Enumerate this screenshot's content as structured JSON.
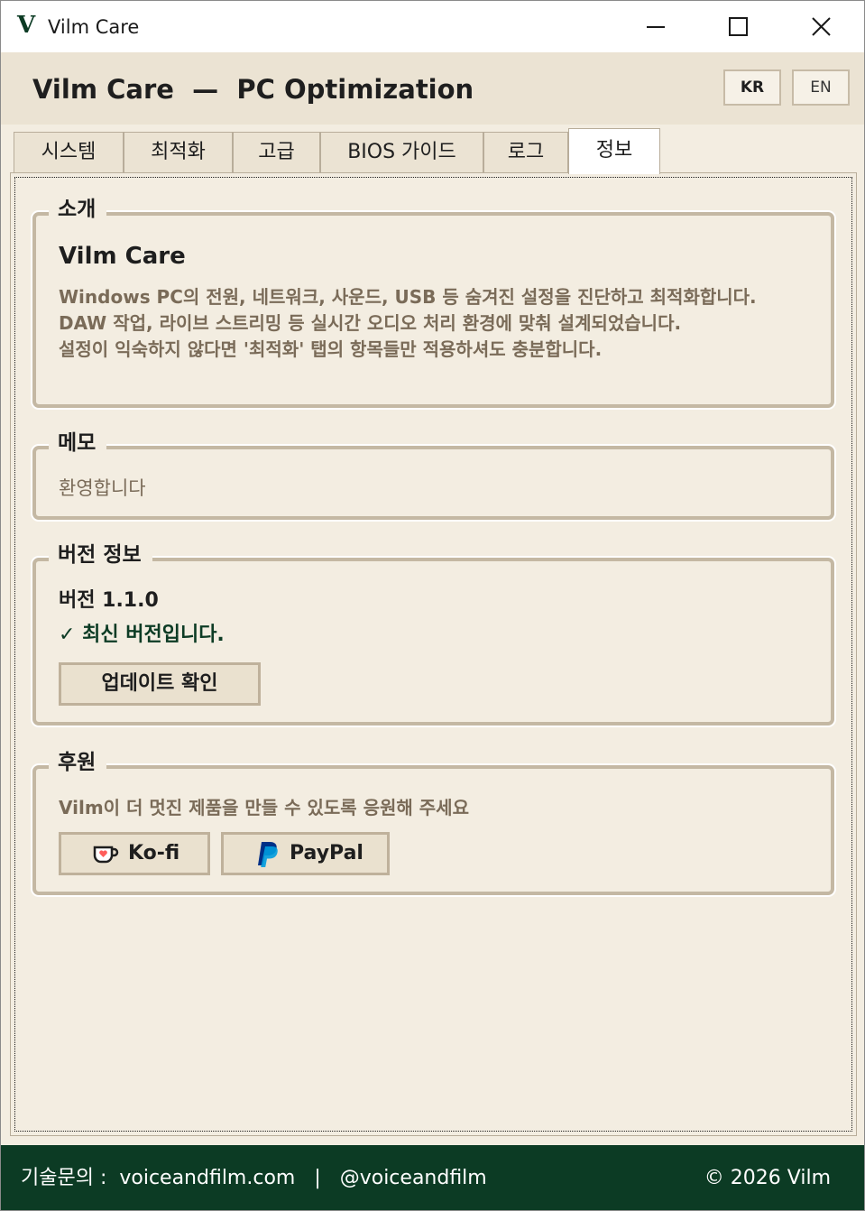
{
  "window": {
    "logo": "V",
    "title": "Vilm Care",
    "icons": {
      "minimize": "minimize-icon",
      "maximize": "maximize-icon",
      "close": "close-icon"
    }
  },
  "header": {
    "app_name": "Vilm Care",
    "separator": "—",
    "subtitle": "PC Optimization",
    "languages": [
      "KR",
      "EN"
    ],
    "selected_language": "KR"
  },
  "tabs": [
    {
      "label": "시스템",
      "active": false
    },
    {
      "label": "최적화",
      "active": false
    },
    {
      "label": "고급",
      "active": false
    },
    {
      "label": "BIOS 가이드",
      "active": false
    },
    {
      "label": "로그",
      "active": false
    },
    {
      "label": "정보",
      "active": true
    }
  ],
  "intro": {
    "title": "소개",
    "app_name": "Vilm Care",
    "description": "Windows PC의 전원, 네트워크, 사운드, USB 등 숨겨진 설정을 진단하고 최적화합니다.\nDAW 작업, 라이브 스트리밍 등 실시간 오디오 처리 환경에 맞춰 설계되었습니다.\n설정이 익숙하지 않다면 '최적화' 탭의 항목들만 적용하셔도 충분합니다."
  },
  "memo": {
    "title": "메모",
    "text": "환영합니다"
  },
  "version": {
    "title": "버전 정보",
    "label": "버전 1.1.0",
    "status": "✓ 최신 버전입니다.",
    "update_button": "업데이트 확인"
  },
  "support": {
    "title": "후원",
    "text": "Vilm이 더 멋진 제품을 만들 수 있도록 응원해 주세요",
    "kofi_label": "Ko-fi",
    "paypal_label": "PayPal"
  },
  "footer": {
    "contact": "기술문의 :  voiceandfilm.com   |   @voiceandfilm",
    "copyright": "© 2026 Vilm"
  },
  "colors": {
    "brand_green": "#0c3b24",
    "background": "#f3ede1",
    "header_bg": "#ebe3d3",
    "muted_text": "#7a6b58",
    "border": "#c4b8a3"
  }
}
